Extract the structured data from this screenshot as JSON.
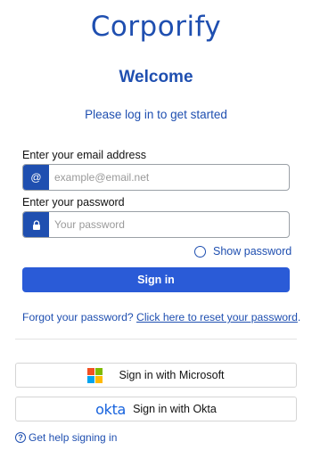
{
  "brand": {
    "logo_text": "Corporify",
    "color": "#1f4fb0"
  },
  "header": {
    "title": "Welcome",
    "subtitle": "Please log in to get started"
  },
  "form": {
    "email_label": "Enter your email address",
    "email_icon": "@",
    "email_placeholder": "example@email.net",
    "email_value": "",
    "password_label": "Enter your password",
    "password_icon": "lock-icon",
    "password_placeholder": "Your password",
    "password_value": "",
    "show_password_label": "Show password",
    "show_password_checked": false,
    "signin_label": "Sign in",
    "signin_color": "#2a5bd7"
  },
  "forgot": {
    "text": "Forgot your password? ",
    "link": "Click here to reset your password",
    "suffix": "."
  },
  "sso": {
    "microsoft_label": "Sign in with Microsoft",
    "microsoft_icon": "microsoft-logo",
    "okta_logo_text": "okta",
    "okta_label": "Sign in with Okta"
  },
  "help": {
    "label": "Get help signing in",
    "icon": "question-circle-icon"
  }
}
